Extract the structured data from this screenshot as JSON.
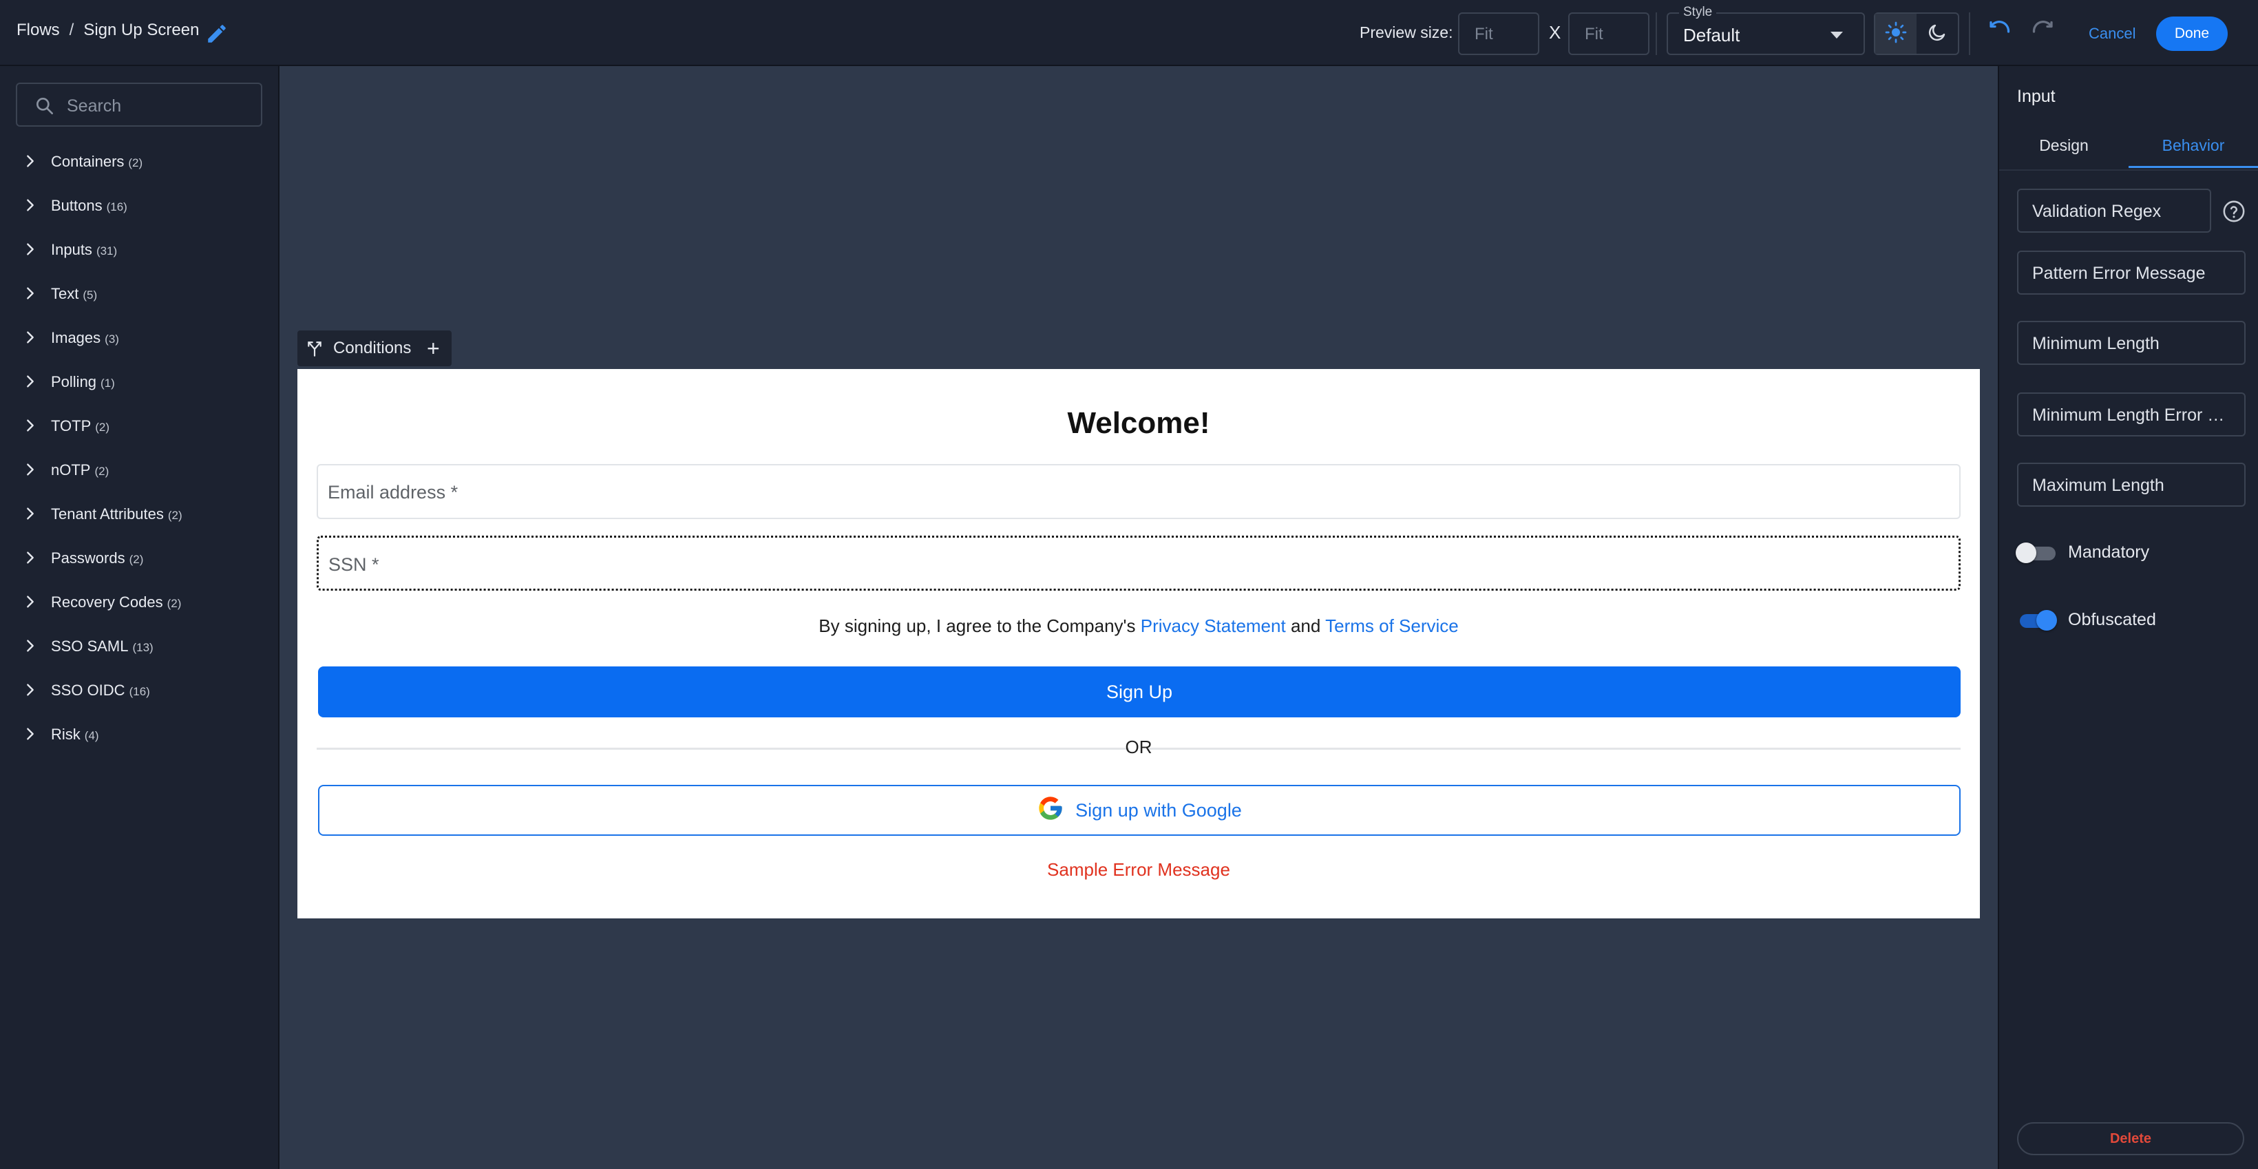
{
  "header": {
    "breadcrumb": [
      "Flows",
      "/",
      "Sign Up Screen"
    ],
    "preview_size_label": "Preview size:",
    "preview_width_placeholder": "Fit",
    "preview_height_placeholder": "Fit",
    "preview_separator": "X",
    "style": {
      "legend": "Style",
      "value": "Default"
    },
    "theme": {
      "active": "light"
    },
    "cancel_label": "Cancel",
    "done_label": "Done"
  },
  "sidebar": {
    "search_placeholder": "Search",
    "categories": [
      {
        "label": "Containers",
        "count": "(2)"
      },
      {
        "label": "Buttons",
        "count": "(16)"
      },
      {
        "label": "Inputs",
        "count": "(31)"
      },
      {
        "label": "Text",
        "count": "(5)"
      },
      {
        "label": "Images",
        "count": "(3)"
      },
      {
        "label": "Polling",
        "count": "(1)"
      },
      {
        "label": "TOTP",
        "count": "(2)"
      },
      {
        "label": "nOTP",
        "count": "(2)"
      },
      {
        "label": "Tenant Attributes",
        "count": "(2)"
      },
      {
        "label": "Passwords",
        "count": "(2)"
      },
      {
        "label": "Recovery Codes",
        "count": "(2)"
      },
      {
        "label": "SSO SAML",
        "count": "(13)"
      },
      {
        "label": "SSO OIDC",
        "count": "(16)"
      },
      {
        "label": "Risk",
        "count": "(4)"
      }
    ]
  },
  "canvas": {
    "conditions_label": "Conditions",
    "form": {
      "title": "Welcome!",
      "email_placeholder": "Email address *",
      "ssn_placeholder": "SSN *",
      "agreement_prefix": "By signing up, I agree to the Company's",
      "privacy_link": "Privacy Statement",
      "agreement_and": "and",
      "terms_link": "Terms of Service",
      "signup_label": "Sign Up",
      "or_label": "OR",
      "google_label": "Sign up with Google",
      "error_message": "Sample Error Message"
    }
  },
  "panel": {
    "title": "Input",
    "tabs": [
      {
        "label": "Design",
        "active": false
      },
      {
        "label": "Behavior",
        "active": true
      }
    ],
    "fields": [
      "Validation Regex",
      "Pattern Error Message",
      "Minimum Length",
      "Minimum Length Error Message",
      "Maximum Length"
    ],
    "toggles": [
      {
        "label": "Mandatory",
        "on": false
      },
      {
        "label": "Obfuscated",
        "on": true
      }
    ],
    "delete_label": "Delete"
  },
  "colors": {
    "accent": "#1677f3",
    "link": "#1a73e8",
    "error": "#e0321f",
    "canvas_bg": "#2f394b",
    "chrome_bg": "#1c2230"
  },
  "icons": [
    "edit-pencil-icon",
    "sun-icon",
    "moon-icon",
    "undo-icon",
    "redo-icon",
    "search-icon",
    "chevron-right-icon",
    "conditions-branch-icon",
    "plus-icon",
    "google-logo-icon",
    "help-circle-icon"
  ]
}
